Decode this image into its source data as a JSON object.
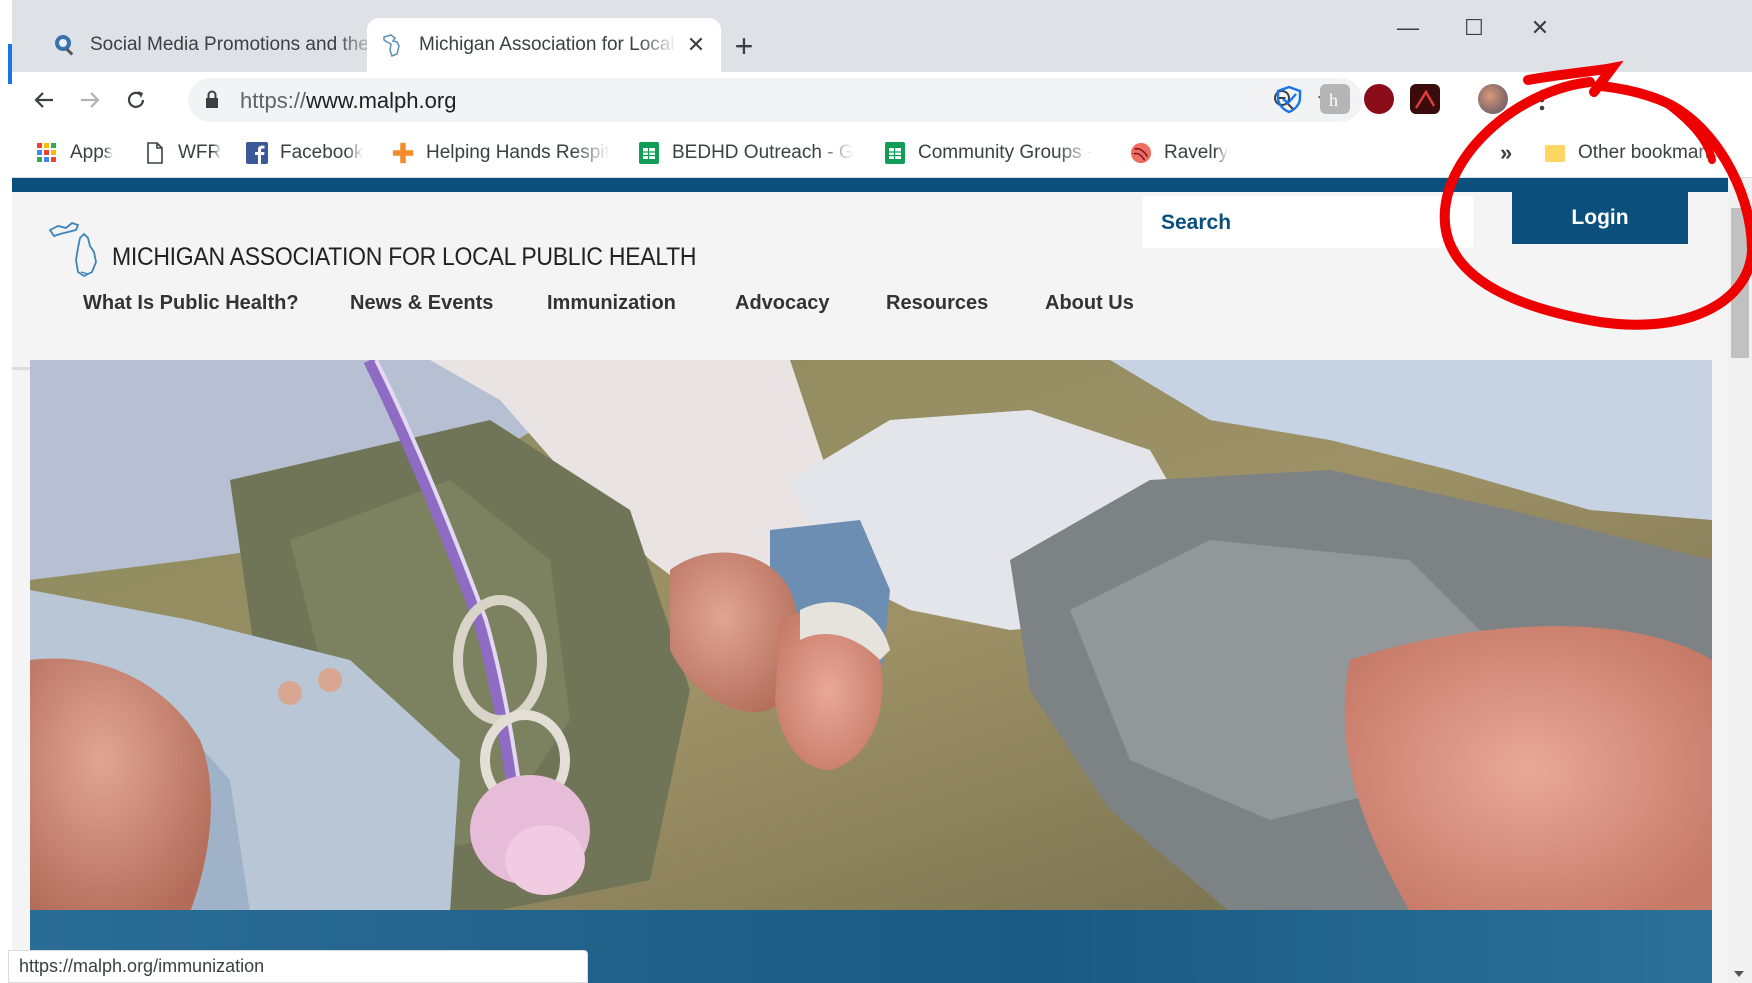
{
  "tabs": [
    {
      "title": "Social Media Promotions and the",
      "favicon": "search-favicon"
    },
    {
      "title": "Michigan Association for Local Pu",
      "favicon": "michigan-favicon"
    }
  ],
  "toolbar": {
    "url_scheme": "https://",
    "url_host": "www.malph.org"
  },
  "bookmarks": [
    {
      "label": "Apps",
      "icon": "apps-icon"
    },
    {
      "label": "WFR",
      "icon": "page-icon"
    },
    {
      "label": "Facebook",
      "icon": "facebook-icon"
    },
    {
      "label": "Helping Hands Respit",
      "icon": "plus-icon"
    },
    {
      "label": "BEDHD Outreach - G",
      "icon": "sheets-icon"
    },
    {
      "label": "Community Groups -",
      "icon": "sheets-icon"
    },
    {
      "label": "Ravelry",
      "icon": "ravelry-icon"
    }
  ],
  "overflow_label": "»",
  "other_bookmarks": "Other bookmarks",
  "site": {
    "logo_text": "MICHIGAN ASSOCIATION FOR LOCAL PUBLIC HEALTH",
    "search_label": "Search",
    "login_label": "Login",
    "nav": [
      "What Is Public Health?",
      "News & Events",
      "Immunization",
      "Advocacy",
      "Resources",
      "About Us"
    ]
  },
  "status_url": "https://malph.org/immunization",
  "colors": {
    "brand_blue": "#0b4f7d",
    "annotation_red": "#ee0000"
  }
}
